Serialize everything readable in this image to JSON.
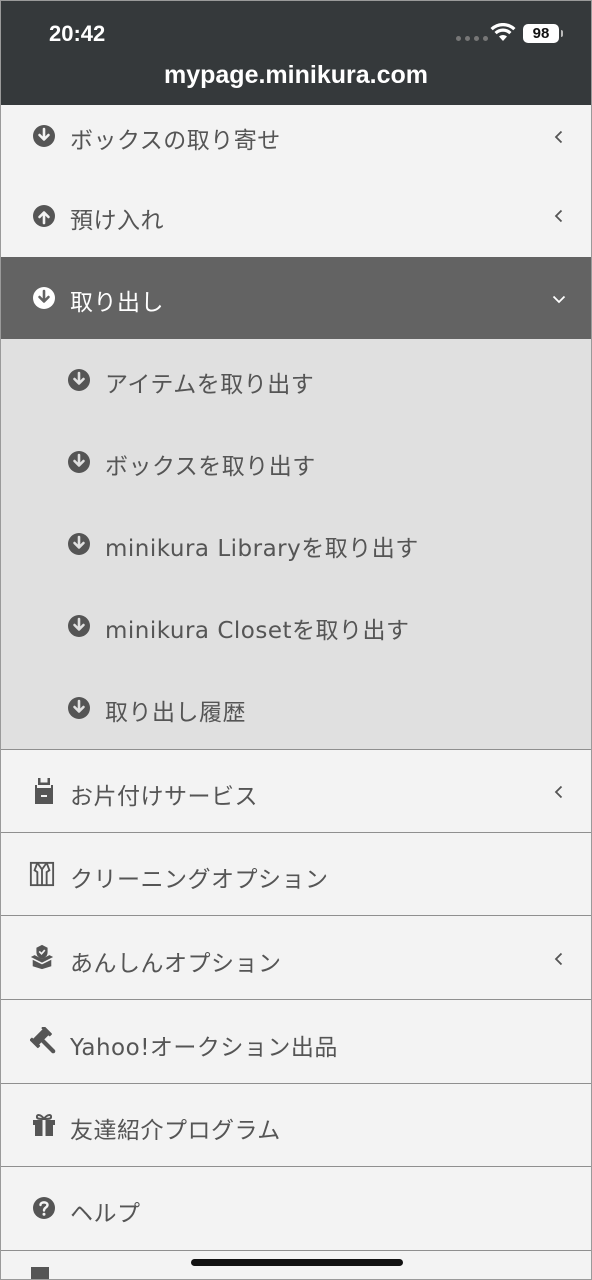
{
  "status_bar": {
    "time": "20:42",
    "battery": "98"
  },
  "browser": {
    "url": "mypage.minikura.com"
  },
  "menu": {
    "box_order": {
      "label": "ボックスの取り寄せ",
      "icon": "arrow-circle-down-icon"
    },
    "deposit": {
      "label": "預け入れ",
      "icon": "arrow-circle-up-icon"
    },
    "retrieve": {
      "label": "取り出し",
      "icon": "arrow-circle-down-icon"
    },
    "retrieve_sub": [
      {
        "label": "アイテムを取り出す"
      },
      {
        "label": "ボックスを取り出す"
      },
      {
        "label": "minikura Libraryを取り出す"
      },
      {
        "label": "minikura Closetを取り出す"
      },
      {
        "label": "取り出し履歴"
      }
    ],
    "tidy_service": {
      "label": "お片付けサービス",
      "icon": "apron-icon"
    },
    "cleaning": {
      "label": "クリーニングオプション",
      "icon": "shirt-icon"
    },
    "anshin": {
      "label": "あんしんオプション",
      "icon": "shield-box-icon"
    },
    "yahoo": {
      "label": "Yahoo!オークション出品",
      "icon": "gavel-icon"
    },
    "referral": {
      "label": "友達紹介プログラム",
      "icon": "gift-icon"
    },
    "help": {
      "label": "ヘルプ",
      "icon": "question-circle-icon"
    }
  },
  "colors": {
    "topbar": "#35393b",
    "active_row": "#636363",
    "sub_row": "#e0e0e0",
    "row": "#f3f3f3",
    "text": "#555555"
  }
}
